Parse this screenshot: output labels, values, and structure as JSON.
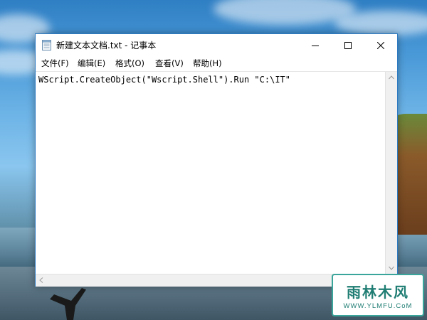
{
  "window": {
    "title": "新建文本文档.txt - 记事本"
  },
  "menu": {
    "items": [
      {
        "label": "文件(F)"
      },
      {
        "label": "编辑(E)"
      },
      {
        "label": "格式(O)"
      },
      {
        "label": "查看(V)"
      },
      {
        "label": "帮助(H)"
      }
    ]
  },
  "editor": {
    "content": "WScript.CreateObject(\"Wscript.Shell\").Run \"C:\\IT\""
  },
  "watermark": {
    "line1": "雨林木风",
    "line2": "WWW.YLMFU.CoM"
  },
  "colors": {
    "window_border": "#2b79c2",
    "watermark": "#1f7d73"
  },
  "icons": {
    "app": "notepad-icon",
    "minimize": "minimize-icon",
    "maximize": "maximize-icon",
    "close": "close-icon"
  }
}
